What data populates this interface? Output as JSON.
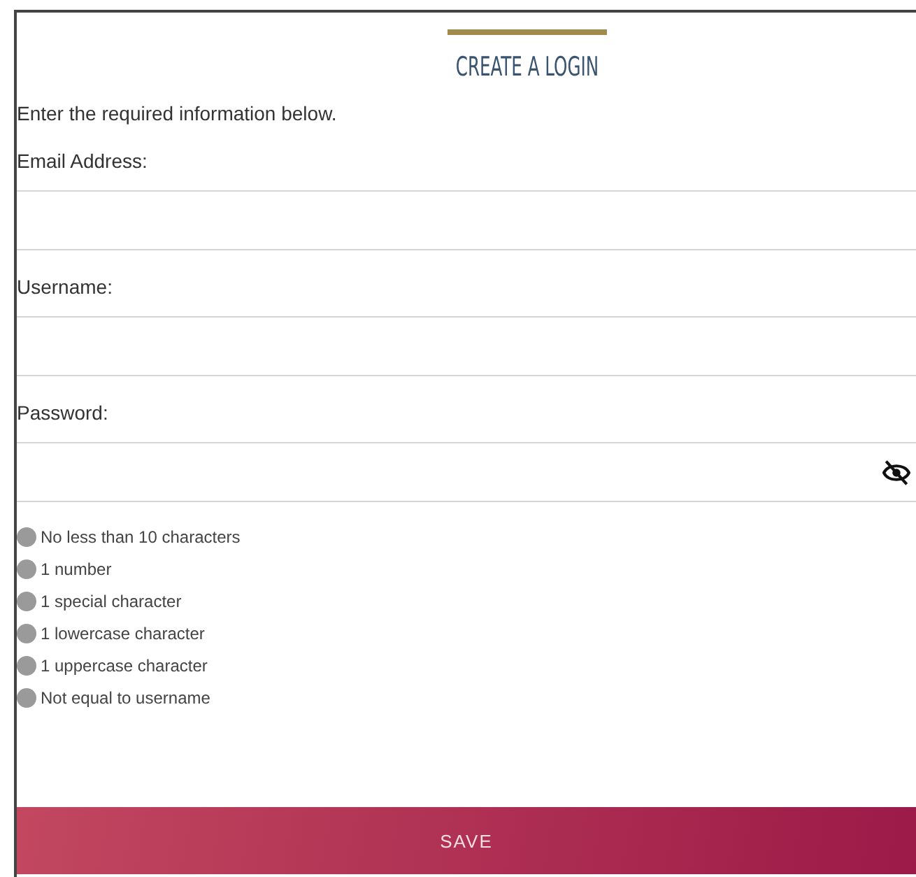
{
  "title": "CREATE A LOGIN",
  "intro": "Enter the required information below.",
  "fields": [
    {
      "label": "Email Address:",
      "kind": "text"
    },
    {
      "label": "Username:",
      "kind": "text"
    },
    {
      "label": "Password:",
      "kind": "password"
    }
  ],
  "requirements": [
    {
      "text": "No less than 10 characters",
      "met": false
    },
    {
      "text": "1 number",
      "met": false
    },
    {
      "text": "1 special character",
      "met": false
    },
    {
      "text": "1 lowercase character",
      "met": false
    },
    {
      "text": "1 uppercase character",
      "met": false
    },
    {
      "text": "Not equal to username",
      "met": false
    }
  ],
  "save_button": "SAVE"
}
